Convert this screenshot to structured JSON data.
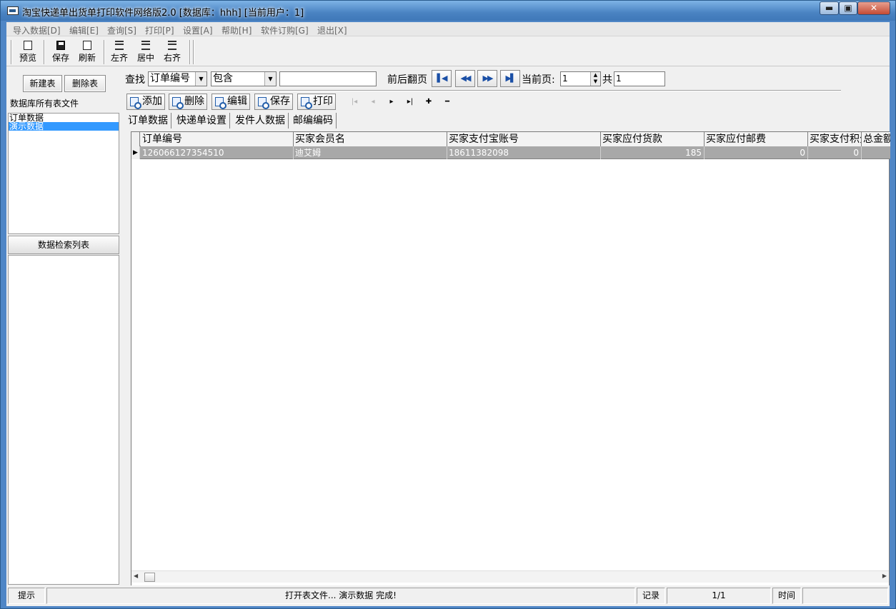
{
  "window": {
    "title": "淘宝快递单出货单打印软件网络版2.0 [数据库：hhh] [当前用户：1]",
    "min_label": "▬",
    "max_label": "▣",
    "close_label": "✕"
  },
  "menu": [
    "导入数据[D]",
    "编辑[E]",
    "查询[S]",
    "打印[P]",
    "设置[A]",
    "帮助[H]",
    "软件订购[G]",
    "退出[X]"
  ],
  "toolbar": {
    "preview": "预览",
    "save": "保存",
    "refresh": "刷新",
    "align_left": "左齐",
    "align_center": "居中",
    "align_right": "右齐"
  },
  "left": {
    "new_table": "新建表",
    "delete_table": "删除表",
    "tables_label": "数据库所有表文件",
    "tables": [
      "订单数据",
      "演示数据"
    ],
    "selected_table": "演示数据",
    "search_list_label": "数据检索列表"
  },
  "search": {
    "label": "查找",
    "field": "订单编号",
    "operator": "包含",
    "value": "",
    "paging_label": "前后翻页",
    "current_page_label": "当前页:",
    "current_page": "1",
    "total_label": "共",
    "total": "1"
  },
  "nav_buttons": {
    "first": "▌◀",
    "prev": "◀◀",
    "next": "▶▶",
    "last": "▶▌"
  },
  "actions": {
    "add": "添加",
    "delete": "删除",
    "edit": "编辑",
    "save": "保存",
    "print": "打印"
  },
  "data_nav": {
    "first": "|◂",
    "prev": "◂",
    "next": "▸",
    "last": "▸|",
    "insert": "✚",
    "remove": "━"
  },
  "tabs": [
    "订单数据",
    "快递单设置",
    "发件人数据",
    "邮编编码"
  ],
  "grid": {
    "columns": [
      "订单编号",
      "买家会员名",
      "买家支付宝账号",
      "买家应付货款",
      "买家应付邮费",
      "买家支付积分",
      "总金额"
    ],
    "rows": [
      [
        "126066127354510",
        "迪艾姆",
        "18611382098",
        "185",
        "0",
        "0",
        ""
      ]
    ],
    "row_indicator": "▶"
  },
  "status": {
    "hint_label": "提示",
    "message": "打开表文件... 演示数据 完成!",
    "records_label": "记录",
    "records": "1/1",
    "time_label": "时间",
    "time": ""
  }
}
